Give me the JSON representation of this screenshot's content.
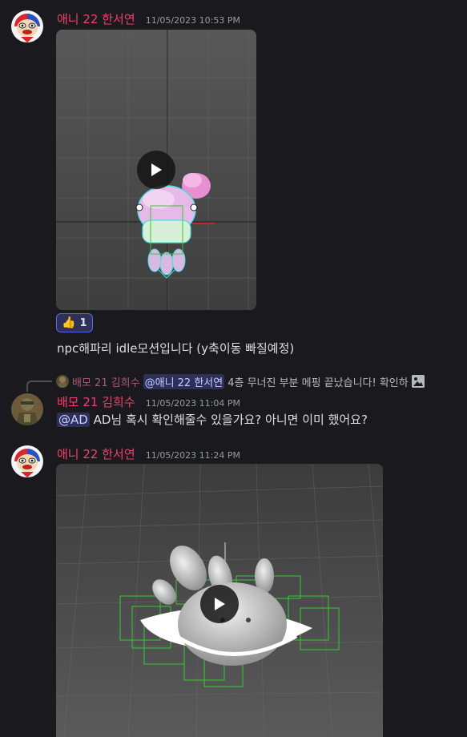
{
  "messages": [
    {
      "author": "애니 22 한서연",
      "timestamp": "11/05/2023 10:53 PM",
      "attachment": {
        "type": "video",
        "subject": "pink-jellyfish-npc-model"
      },
      "reaction": {
        "emoji": "👍",
        "count": "1"
      },
      "text": "npc해파리 idle모션입니다 (y축이동 빠질예정)"
    },
    {
      "reply": {
        "author": "배모 21 김희수",
        "mention": "@애니 22 한서연",
        "text": "4층 무너진 부분 메핑 끝났습니다! 확인하"
      },
      "author": "배모 21 김희수",
      "timestamp": "11/05/2023 11:04 PM",
      "mention": "@AD",
      "text": "AD님 혹시 확인해줄수 있을가요? 아니면 이미 했어요?"
    },
    {
      "author": "애니 22 한서연",
      "timestamp": "11/05/2023 11:24 PM",
      "attachment": {
        "type": "video",
        "subject": "white-rabbit-character-model"
      }
    }
  ],
  "colors": {
    "background": "#1a1a1e",
    "author": "#f23f6f",
    "timestamp": "#949ba4",
    "text": "#dbdee1",
    "mention_bg": "#3c4270",
    "reaction_border": "#5865f2"
  }
}
